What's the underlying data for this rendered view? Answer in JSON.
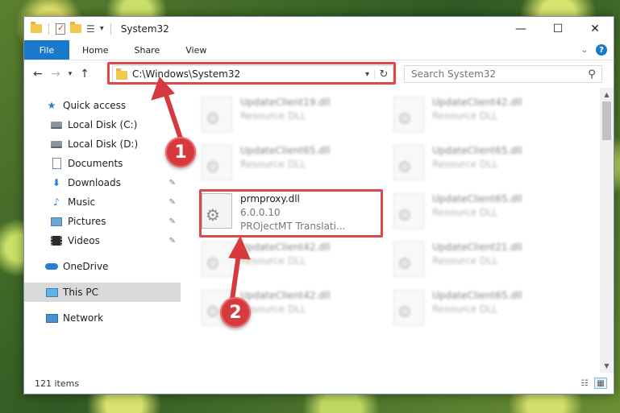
{
  "window": {
    "title": "System32",
    "controls": {
      "minimize": "—",
      "maximize": "☐",
      "close": "✕"
    }
  },
  "ribbon": {
    "tabs": [
      {
        "label": "File"
      },
      {
        "label": "Home"
      },
      {
        "label": "Share"
      },
      {
        "label": "View"
      }
    ],
    "help": "?"
  },
  "address": {
    "path": "C:\\Windows\\System32",
    "search_placeholder": "Search System32"
  },
  "nav": {
    "quick_access": "Quick access",
    "local_c": "Local Disk (C:)",
    "local_d": "Local Disk (D:)",
    "documents": "Documents",
    "downloads": "Downloads",
    "music": "Music",
    "pictures": "Pictures",
    "videos": "Videos",
    "onedrive": "OneDrive",
    "this_pc": "This PC",
    "network": "Network"
  },
  "files": {
    "left": [
      {
        "name": "UpdateClient19.dll",
        "type": "Resource DLL"
      },
      {
        "name": "UpdateClient65.dll",
        "type": "Resource DLL"
      },
      {
        "name": "UpdateClient42.dll",
        "type": "Resource DLL"
      },
      {
        "name": "UpdateClient42.dll",
        "type": "Resource DLL"
      }
    ],
    "right": [
      {
        "name": "UpdateClient42.dll",
        "type": "Resource DLL"
      },
      {
        "name": "UpdateClient65.dll",
        "type": "Resource DLL"
      },
      {
        "name": "UpdateClient65.dll",
        "type": "Resource DLL"
      },
      {
        "name": "UpdateClient21.dll",
        "type": "Resource DLL"
      },
      {
        "name": "UpdateClient65.dll",
        "type": "Resource DLL"
      }
    ],
    "selected": {
      "name": "prmproxy.dll",
      "version": "6.0.0.10",
      "description": "PROjectMT Translati..."
    }
  },
  "status": {
    "item_count": "121 items"
  },
  "annotations": {
    "callout_1": "1",
    "callout_2": "2",
    "color": "#e0474c"
  }
}
